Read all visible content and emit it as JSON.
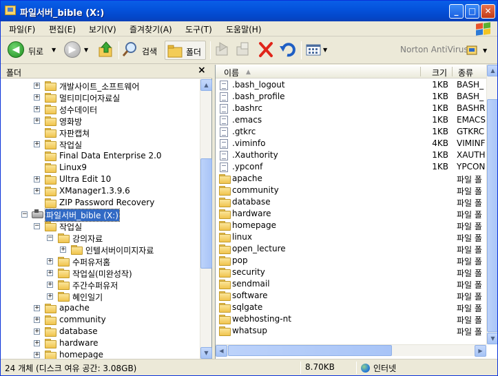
{
  "window": {
    "title": "파일서버_bible (X:)"
  },
  "title_buttons": {
    "minimize": "_",
    "maximize": "□",
    "close": "✕"
  },
  "menu": [
    "파일(F)",
    "편집(E)",
    "보기(V)",
    "즐겨찾기(A)",
    "도구(T)",
    "도움말(H)"
  ],
  "toolbar": {
    "back": "뒤로",
    "search": "검색",
    "folders": "폴더",
    "norton": "Norton AntiVirus"
  },
  "left_pane": {
    "header": "폴더",
    "close": "×"
  },
  "tree": [
    {
      "label": "개발사이트_소프트웨어",
      "exp": "+"
    },
    {
      "label": "멀티미디어자료실",
      "exp": "+"
    },
    {
      "label": "성수데이터",
      "exp": "+"
    },
    {
      "label": "영화방",
      "exp": "+"
    },
    {
      "label": "자판캡쳐",
      "exp": ""
    },
    {
      "label": "작업실",
      "exp": "+"
    },
    {
      "label": "Final Data Enterprise 2.0",
      "exp": ""
    },
    {
      "label": "Linux9",
      "exp": ""
    },
    {
      "label": "Ultra Edit 10",
      "exp": "+"
    },
    {
      "label": "XManager1.3.9.6",
      "exp": "+"
    },
    {
      "label": "ZIP Password Recovery",
      "exp": ""
    },
    {
      "label": "파일서버_bible (X:)",
      "exp": "−"
    },
    {
      "label": "작업실",
      "exp": "−"
    },
    {
      "label": "강의자료",
      "exp": "−"
    },
    {
      "label": "인텔서버이미지자료",
      "exp": "+"
    },
    {
      "label": "수퍼유저홈",
      "exp": "+"
    },
    {
      "label": "작업실(미완성작)",
      "exp": "+"
    },
    {
      "label": "주간수퍼유저",
      "exp": "+"
    },
    {
      "label": "혜인일기",
      "exp": "+"
    },
    {
      "label": "apache",
      "exp": "+"
    },
    {
      "label": "community",
      "exp": "+"
    },
    {
      "label": "database",
      "exp": "+"
    },
    {
      "label": "hardware",
      "exp": "+"
    },
    {
      "label": "homepage",
      "exp": "+"
    }
  ],
  "columns": {
    "name": "이름",
    "size": "크기",
    "type": "종류"
  },
  "files": [
    {
      "name": ".bash_logout",
      "size": "1KB",
      "type": "BASH_"
    },
    {
      "name": ".bash_profile",
      "size": "1KB",
      "type": "BASH_"
    },
    {
      "name": ".bashrc",
      "size": "1KB",
      "type": "BASHR"
    },
    {
      "name": ".emacs",
      "size": "1KB",
      "type": "EMACS"
    },
    {
      "name": ".gtkrc",
      "size": "1KB",
      "type": "GTKRC"
    },
    {
      "name": ".viminfo",
      "size": "4KB",
      "type": "VIMINF"
    },
    {
      "name": ".Xauthority",
      "size": "1KB",
      "type": "XAUTH"
    },
    {
      "name": ".ypconf",
      "size": "1KB",
      "type": "YPCON"
    }
  ],
  "folders": [
    {
      "name": "apache",
      "type": "파일 폴"
    },
    {
      "name": "community",
      "type": "파일 폴"
    },
    {
      "name": "database",
      "type": "파일 폴"
    },
    {
      "name": "hardware",
      "type": "파일 폴"
    },
    {
      "name": "homepage",
      "type": "파일 폴"
    },
    {
      "name": "linux",
      "type": "파일 폴"
    },
    {
      "name": "open_lecture",
      "type": "파일 폴"
    },
    {
      "name": "pop",
      "type": "파일 폴"
    },
    {
      "name": "security",
      "type": "파일 폴"
    },
    {
      "name": "sendmail",
      "type": "파일 폴"
    },
    {
      "name": "software",
      "type": "파일 폴"
    },
    {
      "name": "sqlgate",
      "type": "파일 폴"
    },
    {
      "name": "webhosting-nt",
      "type": "파일 폴"
    },
    {
      "name": "whatsup",
      "type": "파일 폴"
    }
  ],
  "status": {
    "objects": "24 개체 (디스크 여유 공간: 3.08GB)",
    "size": "8.70KB",
    "zone": "인터넷"
  }
}
